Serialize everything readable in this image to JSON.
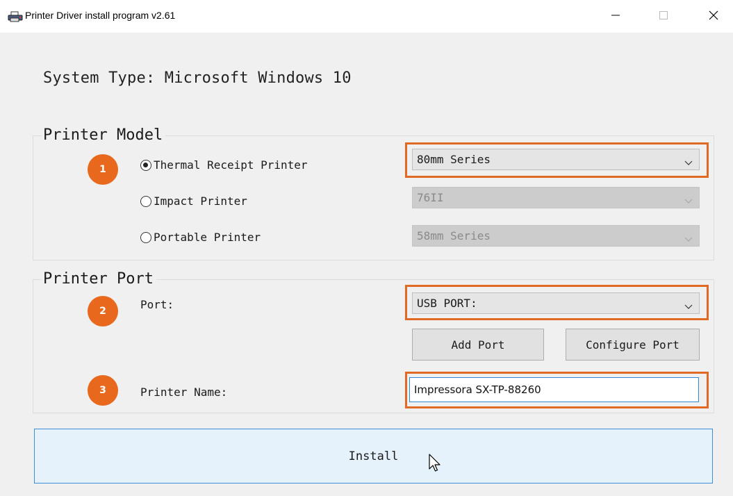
{
  "window": {
    "title": "Printer Driver install program v2.61",
    "icons": {
      "app": "printer-icon",
      "minimize": "minimize-icon",
      "maximize": "maximize-icon",
      "close": "close-icon"
    }
  },
  "system_type": "System Type: Microsoft Windows 10",
  "printer_model": {
    "legend": "Printer Model",
    "step": "1",
    "options": [
      {
        "label": "Thermal Receipt Printer",
        "checked": true,
        "select_value": "80mm Series",
        "enabled": true
      },
      {
        "label": "Impact Printer",
        "checked": false,
        "select_value": "76II",
        "enabled": false
      },
      {
        "label": "Portable Printer",
        "checked": false,
        "select_value": "58mm Series",
        "enabled": false
      }
    ]
  },
  "printer_port": {
    "legend": "Printer Port",
    "port_step": "2",
    "port_label": "Port:",
    "port_value": "USB PORT:",
    "add_port_label": "Add Port",
    "configure_port_label": "Configure Port",
    "name_step": "3",
    "name_label": "Printer Name:",
    "name_value": "Impressora SX-TP-88260"
  },
  "install_label": "Install",
  "colors": {
    "highlight": "#e06a24",
    "badge": "#e8691e",
    "focus_blue": "#2f86d6",
    "install_bg": "#e5f1fb"
  }
}
